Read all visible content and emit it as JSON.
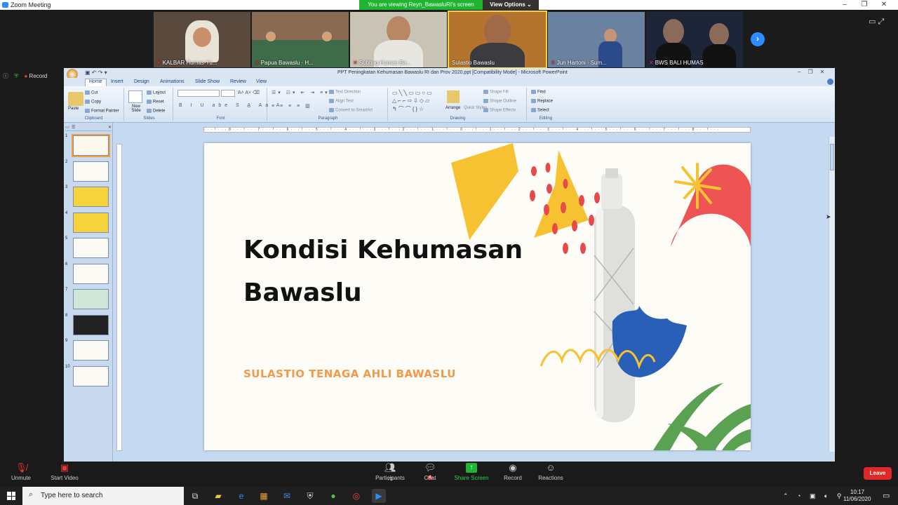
{
  "window": {
    "title": "Zoom Meeting",
    "controls": [
      "–",
      "❐",
      "✕"
    ]
  },
  "share_bar": {
    "viewing_text": "You are viewing Reyn_BawasluRI's screen",
    "options_label": "View Options ⌄"
  },
  "participants_strip": [
    {
      "name": "KALBAR Humas-Yu...",
      "bg": "#5a4a3e"
    },
    {
      "name": "Papua Bawaslu · H...",
      "bg": "#8a6a50"
    },
    {
      "name": "Subbag Humas Ba...",
      "bg": "#c9c3b6"
    },
    {
      "name": "Sulastio Bawaslu",
      "bg": "#b4742e"
    },
    {
      "name": "Jun Hartoni · Sum...",
      "bg": "#6a82a0"
    },
    {
      "name": "BWS BALI HUMAS",
      "bg": "#1d2538"
    }
  ],
  "next_page_icon": "chevron-right-icon",
  "recording_label": "Record",
  "ppt": {
    "title": "PPT Peningkatan Kehumasan Bawaslu RI dan Prov 2020.ppt [Compatibility Mode] - Microsoft PowerPoint",
    "tabs": [
      "Home",
      "Insert",
      "Design",
      "Animations",
      "Slide Show",
      "Review",
      "View"
    ],
    "groups": {
      "clipboard": {
        "label": "Clipboard",
        "paste": "Paste",
        "cut": "Cut",
        "copy": "Copy",
        "format_painter": "Format Painter"
      },
      "slides": {
        "label": "Slides",
        "new_slide": "New Slide",
        "layout": "Layout",
        "reset": "Reset",
        "delete": "Delete"
      },
      "font": {
        "label": "Font"
      },
      "paragraph": {
        "label": "Paragraph",
        "text_direction": "Text Direction",
        "align_text": "Align Text",
        "smartart": "Convert to SmartArt"
      },
      "drawing": {
        "label": "Drawing",
        "arrange": "Arrange",
        "quick_styles": "Quick Styles",
        "shape_fill": "Shape Fill",
        "shape_outline": "Shape Outline",
        "shape_effects": "Shape Effects"
      },
      "editing": {
        "label": "Editing",
        "find": "Find",
        "replace": "Replace",
        "select": "Select"
      }
    },
    "slide_count": 10,
    "slide": {
      "title_line1": "Kondisi  Kehumasan",
      "title_line2": "Bawaslu",
      "subtitle": "SULASTIO  TENAGA AHLI  BAWASLU"
    }
  },
  "controls": {
    "unmute": "Unmute",
    "start_video": "Start Video",
    "participants": "Participants",
    "participants_count": "72",
    "chat": "Chat",
    "chat_badge": "4",
    "share_screen": "Share Screen",
    "record": "Record",
    "reactions": "Reactions",
    "leave": "Leave"
  },
  "taskbar": {
    "search_placeholder": "Type here to search",
    "time": "10:17",
    "date": "11/06/2020"
  },
  "colors": {
    "zoom_blue": "#2d8cff",
    "share_green": "#20b530",
    "leave_red": "#e02828",
    "slide_orange": "#f2994a"
  }
}
